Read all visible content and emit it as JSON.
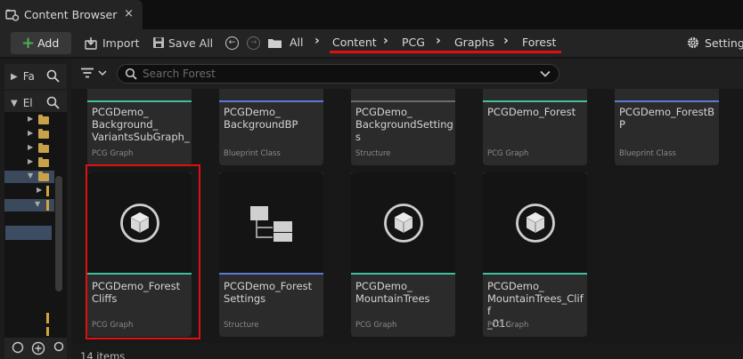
{
  "window": {
    "tab_title": "Content Browser",
    "tab_close_glyph": "×"
  },
  "toolbar": {
    "add_plus_glyph": "+",
    "add_label": "Add",
    "import_label": "Import",
    "save_all_label": "Save All",
    "back_glyph": "←",
    "forward_glyph": "→",
    "settings_label": "Settings"
  },
  "breadcrumb": {
    "sep_glyph": "›",
    "items": [
      "All",
      "Content",
      "PCG",
      "Graphs",
      "Forest"
    ]
  },
  "left_panel": {
    "favorites_label": "Fa",
    "tree_label": "El",
    "collapsed_arrow": "▶",
    "expanded_arrow": "▼"
  },
  "search": {
    "placeholder": "Search Forest"
  },
  "assets": [
    {
      "name": "PCGDemo_\nBackground_\nVariantsSubGraph_",
      "type": "PCG Graph",
      "accent": "#3fbf9f"
    },
    {
      "name": "PCGDemo_\nBackgroundBP",
      "type": "Blueprint Class",
      "accent": "#5a7ad6"
    },
    {
      "name": "PCGDemo_\nBackgroundSettings",
      "type": "Structure",
      "accent": "#6a6a6a"
    },
    {
      "name": "PCGDemo_Forest",
      "type": "PCG Graph",
      "accent": "#3fbf9f"
    },
    {
      "name": "PCGDemo_ForestBP",
      "type": "Blueprint Class",
      "accent": "#5a7ad6"
    },
    {
      "name": "PCGDemo_Forest\nCliffs",
      "type": "PCG Graph",
      "accent": "#3fbf9f"
    },
    {
      "name": "PCGDemo_Forest\nSettings",
      "type": "Structure",
      "accent": "#5a7ad6"
    },
    {
      "name": "PCGDemo_\nMountainTrees",
      "type": "PCG Graph",
      "accent": "#3fbf9f"
    },
    {
      "name": "PCGDemo_\nMountainTrees_Cliff\n_01c",
      "type": "PCG Graph",
      "accent": "#3fbf9f"
    }
  ],
  "status": {
    "item_count": "14 items"
  },
  "colors": {
    "highlight": "#e01010",
    "pcg_accent": "#3fbf9f",
    "blueprint_accent": "#5a7ad6",
    "folder": "#c9a14a"
  }
}
